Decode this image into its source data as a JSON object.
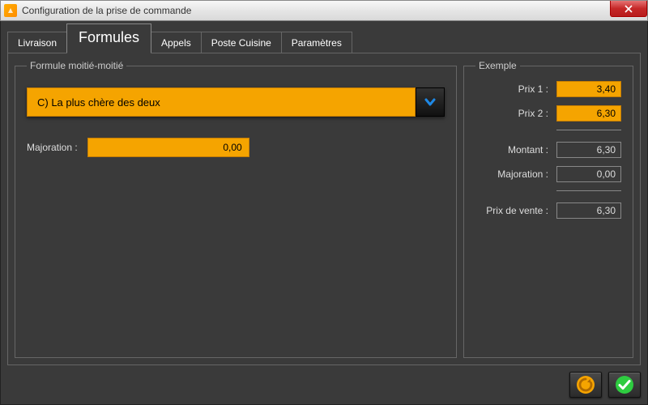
{
  "window": {
    "title": "Configuration de la prise de commande"
  },
  "tabs": {
    "items": [
      {
        "label": "Livraison"
      },
      {
        "label": "Formules"
      },
      {
        "label": "Appels"
      },
      {
        "label": "Poste Cuisine"
      },
      {
        "label": "Paramètres"
      }
    ],
    "active_index": 1
  },
  "left_panel": {
    "legend": "Formule moitié-moitié",
    "dropdown_value": "C) La plus chère des deux",
    "majoration_label": "Majoration :",
    "majoration_value": "0,00"
  },
  "right_panel": {
    "legend": "Exemple",
    "rows": {
      "prix1_label": "Prix 1 :",
      "prix1_value": "3,40",
      "prix2_label": "Prix 2 :",
      "prix2_value": "6,30",
      "montant_label": "Montant :",
      "montant_value": "6,30",
      "majoration_label": "Majoration :",
      "majoration_value": "0,00",
      "pdv_label": "Prix de vente :",
      "pdv_value": "6,30"
    }
  },
  "colors": {
    "accent_orange": "#f5a400",
    "bg_dark": "#3a3a3a"
  }
}
